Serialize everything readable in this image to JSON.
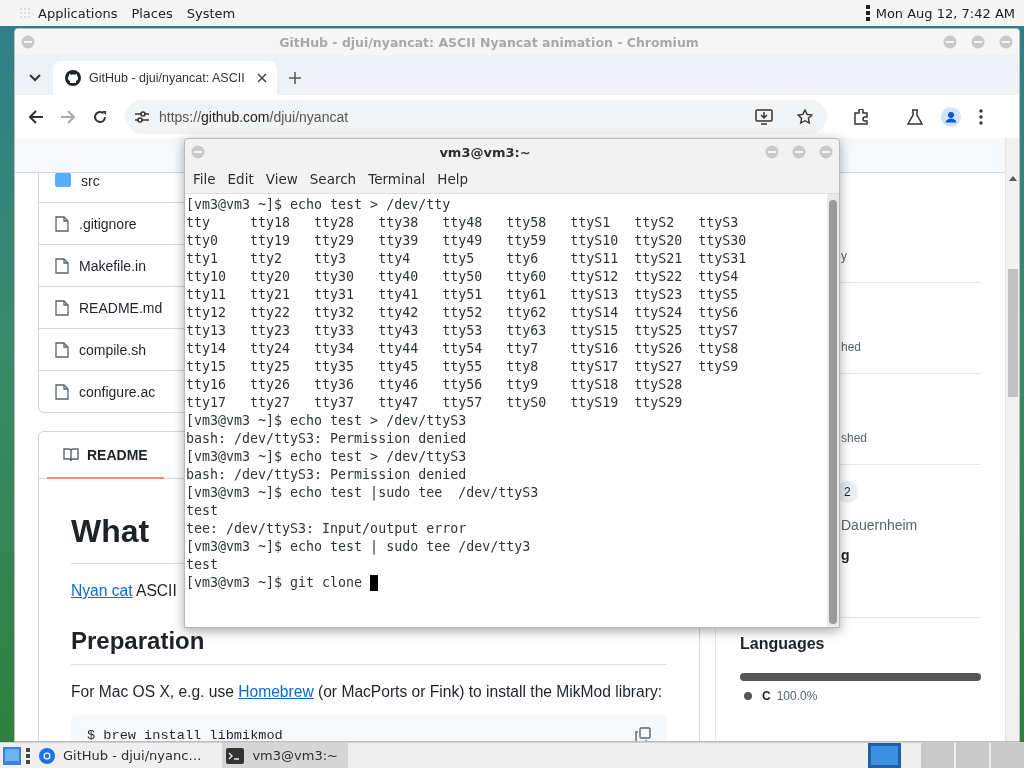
{
  "top_panel": {
    "menus": [
      "Applications",
      "Places",
      "System"
    ],
    "clock": "Mon Aug 12, 7:42 AM"
  },
  "browser": {
    "title": "GitHub - djui/nyancat: ASCII Nyancat animation - Chromium",
    "tabs": [
      {
        "label": "GitHub - djui/nyancat: ASCII",
        "selected": true
      }
    ],
    "url": {
      "scheme": "https://",
      "host": "github.com",
      "path": "/djui/nyancat"
    },
    "page": {
      "files": [
        {
          "kind": "folder",
          "name": "src"
        },
        {
          "kind": "file",
          "name": ".gitignore"
        },
        {
          "kind": "file",
          "name": "Makefile.in"
        },
        {
          "kind": "file",
          "name": "README.md"
        },
        {
          "kind": "file",
          "name": "compile.sh"
        },
        {
          "kind": "file",
          "name": "configure.ac"
        }
      ],
      "readme_tab": "README",
      "heading": "What",
      "intro": {
        "link": "Nyan cat",
        "text": " ASCII"
      },
      "section_heading": "Preparation",
      "paragraph": {
        "before": "For Mac OS X, e.g. use ",
        "link": "Homebrew",
        "after": " (or MacPorts or Fink) to install the MikMod library:"
      },
      "code": "$ brew install libmikmod",
      "sidebar": {
        "sections": [
          {
            "items": [
              {
                "kind": "text",
                "text": "y"
              }
            ]
          },
          {
            "items": [
              {
                "kind": "text",
                "text": "hed"
              }
            ]
          },
          {
            "items": [
              {
                "kind": "text",
                "text": "shed"
              }
            ]
          },
          {
            "items": [
              {
                "kind": "count",
                "text": "2"
              },
              {
                "kind": "text",
                "text": "Dauernheim"
              },
              {
                "kind": "heading",
                "text": "g"
              }
            ]
          }
        ],
        "languages": {
          "title": "Languages",
          "items": [
            {
              "name": "C",
              "percent": "100.0%",
              "color": "#555555",
              "level": 1
            }
          ]
        }
      }
    }
  },
  "terminal": {
    "title": "vm3@vm3:~",
    "menus": [
      "File",
      "Edit",
      "View",
      "Search",
      "Terminal",
      "Help"
    ],
    "lines": [
      "[vm3@vm3 ~]$ echo test > /dev/tty",
      "tty     tty18   tty28   tty38   tty48   tty58   ttyS1   ttyS2   ttyS3",
      "tty0    tty19   tty29   tty39   tty49   tty59   ttyS10  ttyS20  ttyS30",
      "tty1    tty2    tty3    tty4    tty5    tty6    ttyS11  ttyS21  ttyS31",
      "tty10   tty20   tty30   tty40   tty50   tty60   ttyS12  ttyS22  ttyS4",
      "tty11   tty21   tty31   tty41   tty51   tty61   ttyS13  ttyS23  ttyS5",
      "tty12   tty22   tty32   tty42   tty52   tty62   ttyS14  ttyS24  ttyS6",
      "tty13   tty23   tty33   tty43   tty53   tty63   ttyS15  ttyS25  ttyS7",
      "tty14   tty24   tty34   tty44   tty54   tty7    ttyS16  ttyS26  ttyS8",
      "tty15   tty25   tty35   tty45   tty55   tty8    ttyS17  ttyS27  ttyS9",
      "tty16   tty26   tty36   tty46   tty56   tty9    ttyS18  ttyS28",
      "tty17   tty27   tty37   tty47   tty57   ttyS0   ttyS19  ttyS29",
      "[vm3@vm3 ~]$ echo test > /dev/ttyS3",
      "bash: /dev/ttyS3: Permission denied",
      "[vm3@vm3 ~]$ echo test > /dev/ttyS3",
      "bash: /dev/ttyS3: Permission denied",
      "[vm3@vm3 ~]$ echo test |sudo tee  /dev/ttyS3",
      "test",
      "tee: /dev/ttyS3: Input/output error",
      "[vm3@vm3 ~]$ echo test | sudo tee /dev/tty3",
      "test",
      "[vm3@vm3 ~]$ git clone "
    ]
  },
  "taskbar": {
    "items": [
      {
        "kind": "browser",
        "label": "GitHub - djui/nyanc…",
        "selected": false
      },
      {
        "kind": "terminal",
        "label": "vm3@vm3:~",
        "selected": true
      }
    ],
    "workspaces": [
      {
        "selected": true
      },
      {
        "selected": false
      },
      {
        "selected": false
      },
      {
        "selected": false
      }
    ]
  }
}
